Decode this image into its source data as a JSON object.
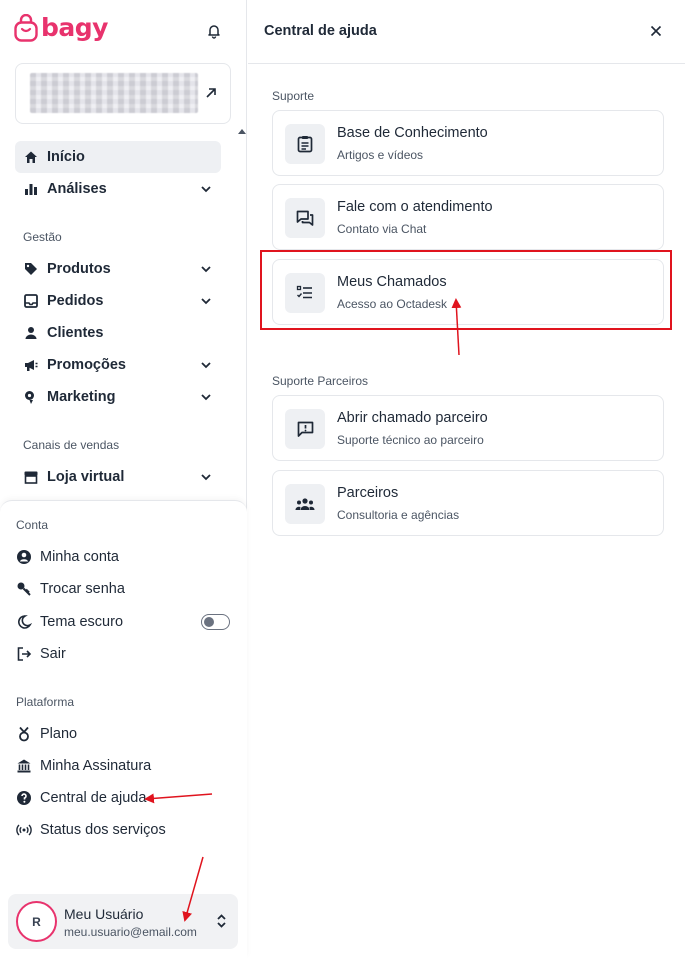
{
  "brand": {
    "name": "bagy",
    "accent_color": "#e8336d"
  },
  "sidebar": {
    "nav": [
      {
        "label": "Início",
        "icon": "home-icon",
        "active": true
      },
      {
        "label": "Análises",
        "icon": "bar-chart-icon"
      }
    ],
    "sections": [
      {
        "label": "Gestão"
      },
      {
        "label": "Canais de vendas"
      }
    ],
    "gestao_items": [
      {
        "label": "Produtos",
        "icon": "tag-icon"
      },
      {
        "label": "Pedidos",
        "icon": "inbox-icon"
      },
      {
        "label": "Clientes",
        "icon": "person-icon"
      },
      {
        "label": "Promoções",
        "icon": "megaphone-icon"
      },
      {
        "label": "Marketing",
        "icon": "marketing-icon"
      }
    ],
    "canais_items": [
      {
        "label": "Loja virtual",
        "icon": "store-icon"
      }
    ]
  },
  "account": {
    "conta_label": "Conta",
    "conta_items": [
      {
        "label": "Minha conta",
        "icon": "user-circle-icon"
      },
      {
        "label": "Trocar senha",
        "icon": "key-icon"
      },
      {
        "label": "Tema escuro",
        "icon": "moon-icon",
        "toggle": false
      },
      {
        "label": "Sair",
        "icon": "logout-icon"
      }
    ],
    "plataforma_label": "Plataforma",
    "plataforma_items": [
      {
        "label": "Plano",
        "icon": "medal-icon"
      },
      {
        "label": "Minha Assinatura",
        "icon": "bank-icon"
      },
      {
        "label": "Central de ajuda",
        "icon": "help-circle-icon"
      },
      {
        "label": "Status dos serviços",
        "icon": "broadcast-icon"
      }
    ]
  },
  "user": {
    "initial": "R",
    "name": "Meu Usuário",
    "email": "meu.usuario@email.com"
  },
  "help": {
    "title": "Central de ajuda",
    "suporte_label": "Suporte",
    "suporte_items": [
      {
        "title": "Base de Conhecimento",
        "subtitle": "Artigos e vídeos",
        "icon": "clipboard-icon"
      },
      {
        "title": "Fale com o atendimento",
        "subtitle": "Contato via Chat",
        "icon": "chat-icon"
      },
      {
        "title": "Meus Chamados",
        "subtitle": "Acesso ao Octadesk",
        "icon": "checklist-icon"
      }
    ],
    "parceiros_label": "Suporte Parceiros",
    "parceiros_items": [
      {
        "title": "Abrir chamado parceiro",
        "subtitle": "Suporte técnico ao parceiro",
        "icon": "feedback-icon"
      },
      {
        "title": "Parceiros",
        "subtitle": "Consultoria e agências",
        "icon": "group-icon"
      }
    ]
  },
  "annotations": {
    "color": "#e0141e"
  }
}
